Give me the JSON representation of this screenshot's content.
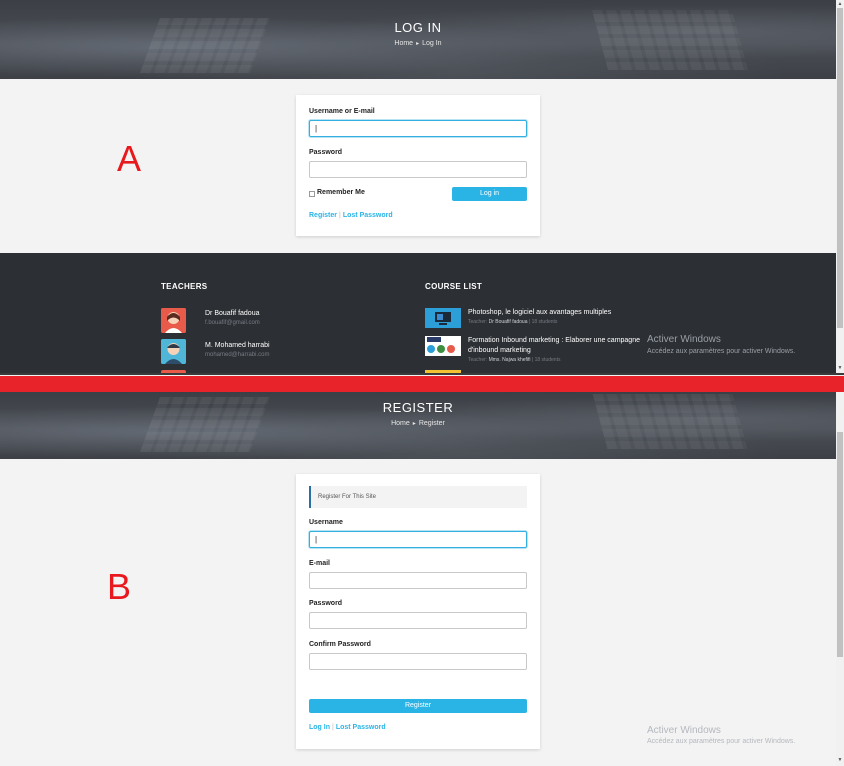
{
  "panel_a": {
    "title": "LOG IN",
    "breadcrumb": {
      "home": "Home",
      "separator": "▸",
      "current": "Log In"
    },
    "annotation_letter": "A",
    "form": {
      "username_label": "Username or E-mail",
      "username_value": "|",
      "password_label": "Password",
      "password_value": "",
      "remember_label": "Remember Me",
      "submit_label": "Log in",
      "register_link": "Register",
      "lost_password_link": "Lost Password",
      "link_separator": "|"
    },
    "footer": {
      "teachers_heading": "TEACHERS",
      "teachers": [
        {
          "name": "Dr Bouafif fadoua",
          "email": "f.bouafif@gmail.com"
        },
        {
          "name": "M. Mohamed harrabi",
          "email": "mohamed@harrabi.com"
        }
      ],
      "courses_heading": "COURSE LIST",
      "courses": [
        {
          "title": "Photoshop, le logiciel aux avantages multiples",
          "teacher_prefix": "Teacher:",
          "teacher": "Dr Bouafif fadoua",
          "students": "18 students"
        },
        {
          "title": "Formation Inbound marketing : Elaborer une campagne d'inbound marketing",
          "teacher_prefix": "Teacher:",
          "teacher": "Mms. Najwa khefifi",
          "students": "18 students"
        }
      ]
    },
    "windows_activation": {
      "title": "Activer Windows",
      "subtitle": "Accédez aux paramètres pour activer Windows."
    }
  },
  "panel_b": {
    "title": "REGISTER",
    "breadcrumb": {
      "home": "Home",
      "separator": "▸",
      "current": "Register"
    },
    "annotation_letter": "B",
    "form": {
      "notice": "Register For This Site",
      "username_label": "Username",
      "username_value": "|",
      "email_label": "E-mail",
      "password_label": "Password",
      "confirm_password_label": "Confirm Password",
      "submit_label": "Register",
      "login_link": "Log In",
      "lost_password_link": "Lost Password",
      "link_separator": "|"
    },
    "windows_activation": {
      "title": "Activer Windows",
      "subtitle": "Accédez aux paramètres pour activer Windows."
    }
  },
  "colors": {
    "accent": "#2ab4e6",
    "annotation_red": "#e8191e",
    "divider_red": "#e8232a",
    "footer_bg": "#2c2f33"
  },
  "icons": {
    "breadcrumb_separator": "caret-right-icon",
    "scroll_up": "scroll-up-arrow-icon",
    "scroll_down": "scroll-down-arrow-icon"
  }
}
